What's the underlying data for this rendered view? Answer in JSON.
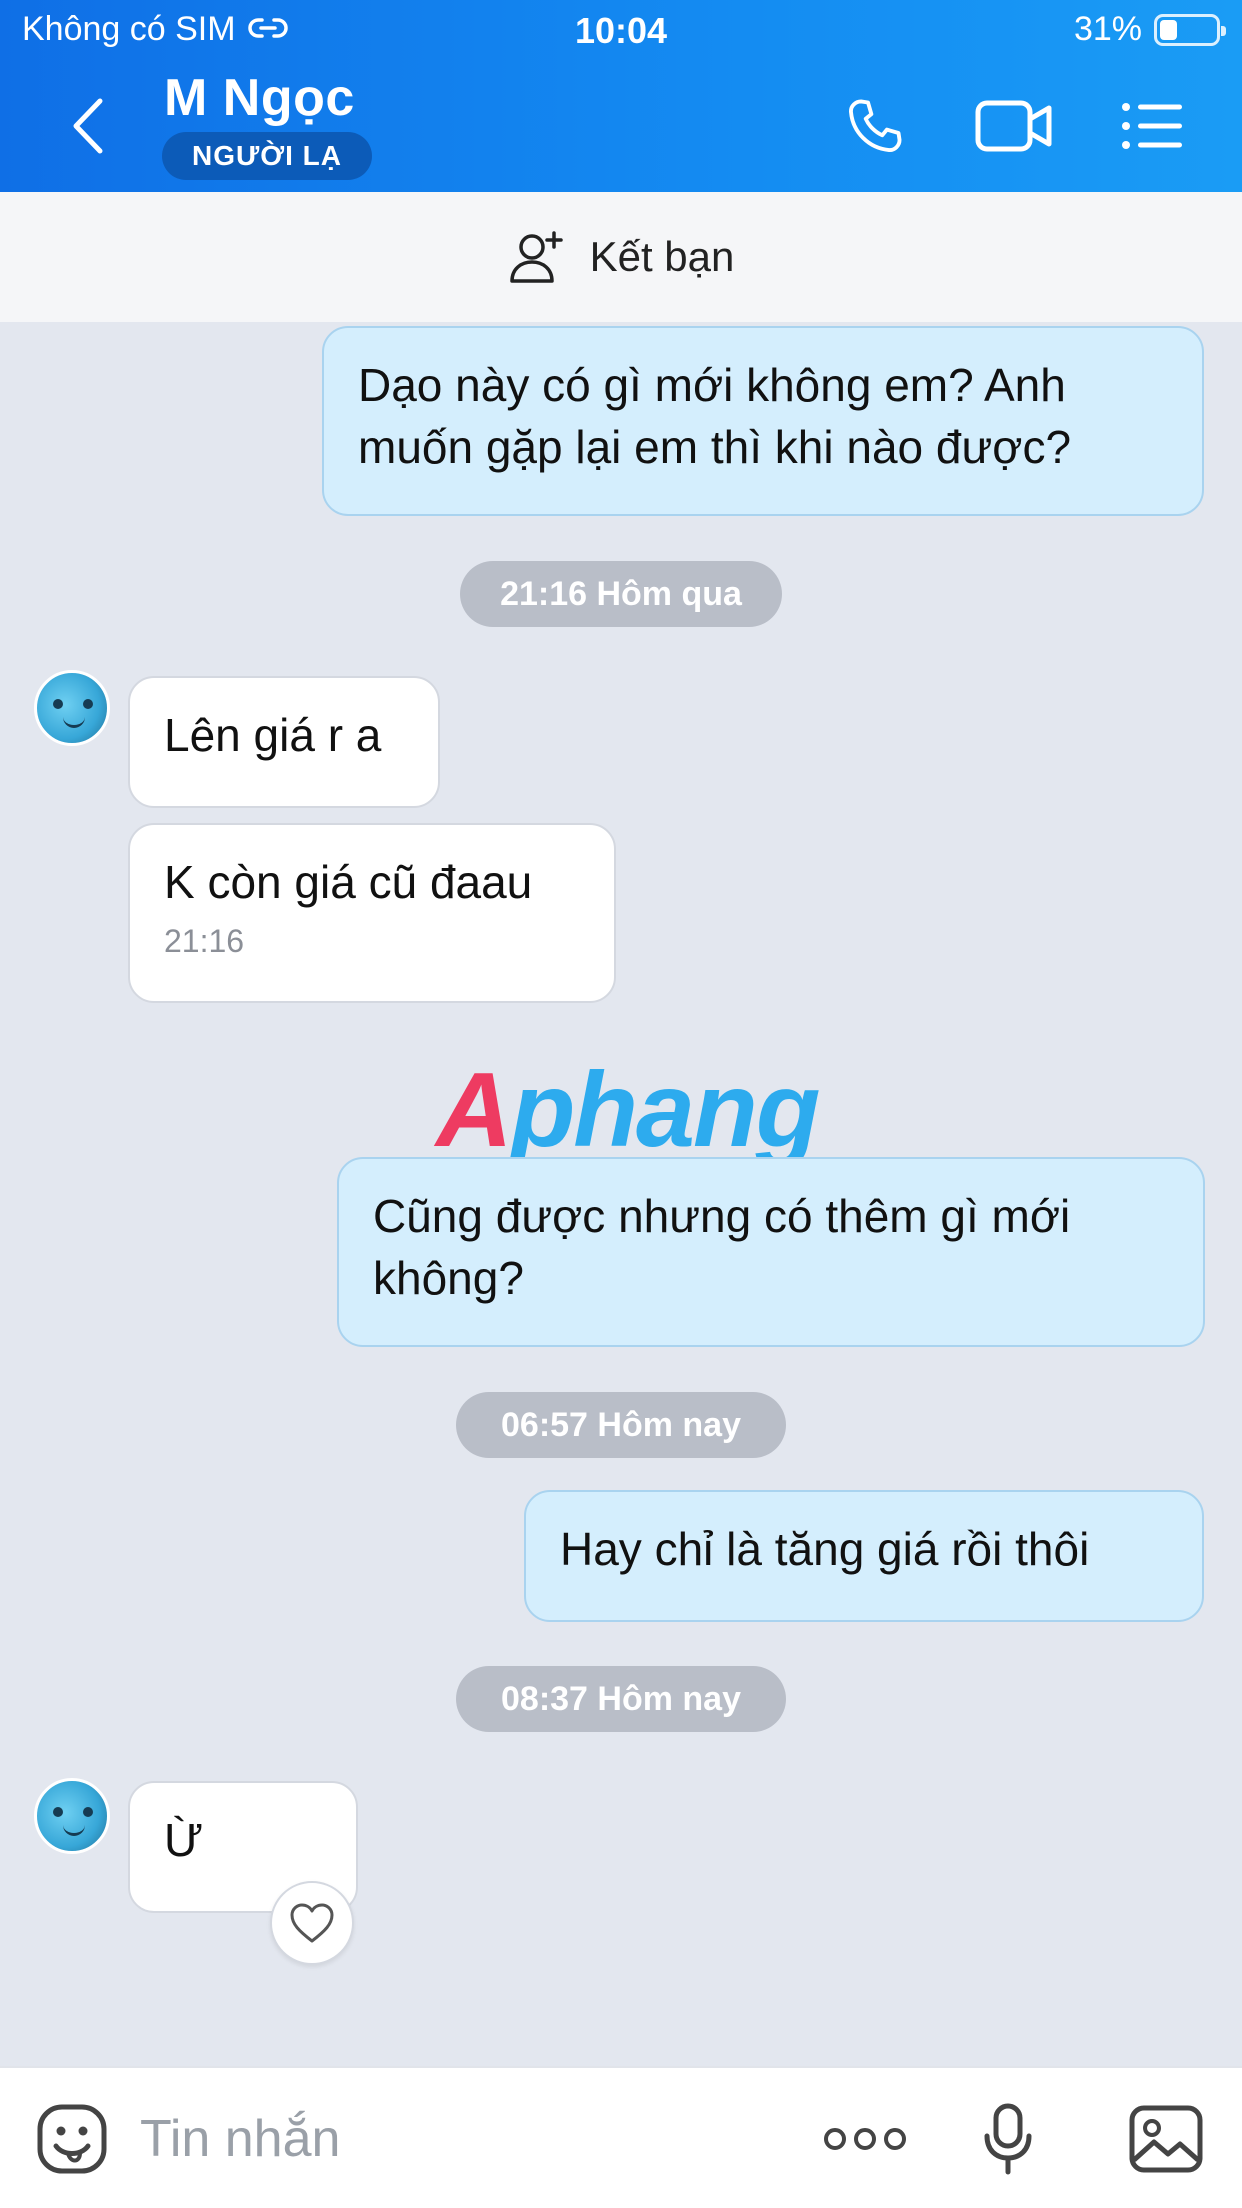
{
  "status_bar": {
    "carrier": "Không có SIM",
    "time": "10:04",
    "battery_percent": "31%",
    "battery_level": 0.31
  },
  "header": {
    "contact_name": "M Ngọc",
    "badge": "NGƯỜI LẠ",
    "icons": [
      "back-chevron-icon",
      "phone-call-icon",
      "video-call-icon",
      "menu-list-icon"
    ]
  },
  "add_friend": {
    "label": "Kết bạn",
    "icon": "add-user-icon"
  },
  "messages": [
    {
      "direction": "out",
      "text": "Dạo này có gì mới không em? Anh muốn gặp lại em thì khi nào được?"
    },
    {
      "type": "timestamp",
      "text": "21:16 Hôm qua"
    },
    {
      "direction": "in",
      "text": "Lên giá r a"
    },
    {
      "direction": "in",
      "text": "K còn giá cũ đaau",
      "time": "21:16"
    },
    {
      "direction": "out",
      "text": "Cũng được nhưng có thêm gì mới không?"
    },
    {
      "type": "timestamp",
      "text": "06:57 Hôm nay"
    },
    {
      "direction": "out",
      "text": "Hay chỉ là tăng giá rồi thôi"
    },
    {
      "type": "timestamp",
      "text": "08:37 Hôm nay"
    },
    {
      "direction": "in",
      "text": "Ừ"
    }
  ],
  "watermark": {
    "first": "A",
    "rest": "phang"
  },
  "composer": {
    "placeholder": "Tin nhắn",
    "icons": [
      "sticker-icon",
      "more-options-icon",
      "microphone-icon",
      "image-icon"
    ]
  },
  "colors": {
    "header_blue": "#148cf2",
    "outgoing_bubble": "#d4eefd",
    "incoming_bubble": "#ffffff",
    "chat_background": "#e3e7ef",
    "timestamp_pill": "#b9bec8"
  }
}
